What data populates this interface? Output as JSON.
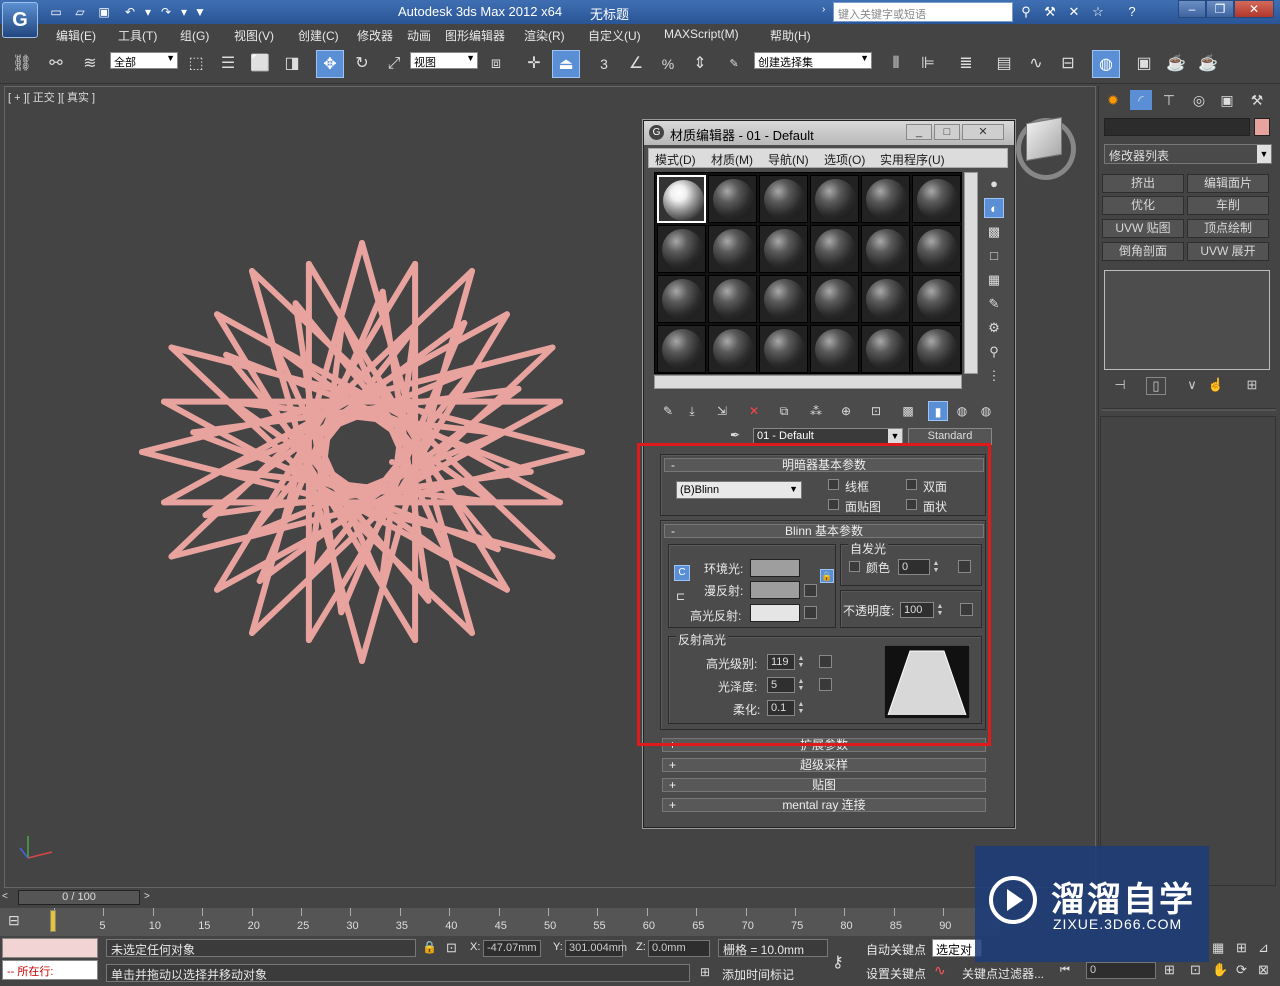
{
  "app": {
    "title": "Autodesk 3ds Max  2012 x64",
    "file": "无标题",
    "search_placeholder": "键入关键字或短语",
    "logo": "G"
  },
  "menu": [
    "编辑(E)",
    "工具(T)",
    "组(G)",
    "视图(V)",
    "创建(C)",
    "修改器",
    "动画",
    "图形编辑器",
    "渲染(R)",
    "自定义(U)",
    "MAXScript(M)",
    "帮助(H)"
  ],
  "toolbar": {
    "selection_filter": "全部",
    "ref_coord": "视图",
    "named_selection": "创建选择集",
    "snap_labels": [
      "3",
      "%"
    ]
  },
  "viewport": {
    "label": "[ + ][ 正交 ][ 真实 ]",
    "object_color": "#e8a39f"
  },
  "command_panel": {
    "modifier_list": "修改器列表",
    "buttons": [
      "挤出",
      "编辑面片",
      "优化",
      "车削",
      "UVW 贴图",
      "顶点绘制",
      "倒角剖面",
      "UVW 展开"
    ],
    "object_color": "#e8a39f"
  },
  "material_editor": {
    "title": "材质编辑器 - 01 - Default",
    "menu": [
      "模式(D)",
      "材质(M)",
      "导航(N)",
      "选项(O)",
      "实用程序(U)"
    ],
    "material_name": "01 - Default",
    "material_type": "Standard",
    "shader_rollout": {
      "title": "明暗器基本参数",
      "shader": "(B)Blinn",
      "options": [
        "线框",
        "双面",
        "面贴图",
        "面状"
      ]
    },
    "blinn_rollout": {
      "title": "Blinn 基本参数",
      "ambient_label": "环境光:",
      "diffuse_label": "漫反射:",
      "specular_label": "高光反射:",
      "self_illum_group": "自发光",
      "color_label": "颜色",
      "self_illum_value": "0",
      "opacity_label": "不透明度:",
      "opacity_value": "100",
      "spec_group": "反射高光",
      "spec_level_label": "高光级别:",
      "spec_level_value": "119",
      "glossiness_label": "光泽度:",
      "glossiness_value": "5",
      "soften_label": "柔化:",
      "soften_value": "0.1"
    },
    "collapsed_rollouts": [
      "扩展参数",
      "超级采样",
      "贴图",
      "mental ray 连接"
    ],
    "ambient_color": "#9e9e9e",
    "diffuse_color": "#9e9e9e",
    "specular_color": "#e5e5e5"
  },
  "timeline": {
    "frame_display": "0 / 100",
    "ticks": [
      "0",
      "5",
      "10",
      "15",
      "20",
      "25",
      "30",
      "35",
      "40",
      "45",
      "50",
      "55",
      "60",
      "65",
      "70",
      "75",
      "80",
      "85",
      "90"
    ]
  },
  "status": {
    "selection": "未选定任何对象",
    "prompt": "单击并拖动以选择并移动对象",
    "listener": "所在行:",
    "x_label": "X:",
    "x_value": "-47.07mm",
    "y_label": "Y:",
    "y_value": "301.004mm",
    "z_label": "Z:",
    "z_value": "0.0mm",
    "grid": "栅格 = 10.0mm",
    "auto_key": "自动关键点",
    "selected": "选定对",
    "set_key": "设置关键点",
    "key_filters": "关键点过滤器...",
    "add_time_tag": "添加时间标记",
    "frame": "0"
  },
  "watermark": {
    "brand": "溜溜自学",
    "url": "ZIXUE.3D66.COM"
  }
}
